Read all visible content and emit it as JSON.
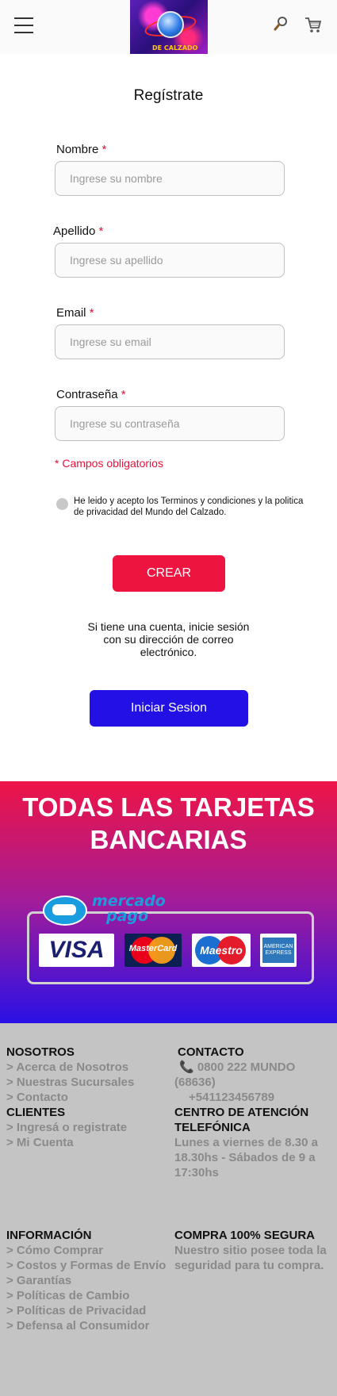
{
  "header": {
    "menu_icon": "hamburger-menu-icon",
    "logo_text": "DE CALZADO",
    "search_icon": "magnifier-icon",
    "cart_icon": "shopping-cart-icon"
  },
  "form": {
    "title": "Regístrate",
    "fields": [
      {
        "label": "Nombre",
        "placeholder": "Ingrese su nombre"
      },
      {
        "label": "Apellido",
        "placeholder": "Ingrese su apellido"
      },
      {
        "label": "Email",
        "placeholder": "Ingrese su email"
      },
      {
        "label": "Contraseña",
        "placeholder": "Ingrese su contraseña"
      }
    ],
    "required_mark": "*",
    "required_note": "* Campos obligatorios",
    "terms_text": "He leido y acepto los Terminos y condiciones  y la politica de privacidad del Mundo del Calzado.",
    "create_label": "CREAR",
    "login_hint": "Si tiene una cuenta, inicie sesión con su dirección de correo electrónico.",
    "login_label": "Iniciar Sesion"
  },
  "banner": {
    "title": "TODAS LAS TARJETAS BANCARIAS",
    "mercadopago_text_1": "mercado",
    "mercadopago_text_2": "pago",
    "cards": [
      "VISA",
      "MasterCard",
      "Maestro",
      "AMERICAN EXPRESS"
    ]
  },
  "footer": {
    "nosotros": {
      "heading": "NOSOTROS",
      "links": [
        "> Acerca de Nosotros",
        "> Nuestras Sucursales",
        "> Contacto"
      ]
    },
    "clientes": {
      "heading": "CLIENTES",
      "links": [
        "> Ingresá o registrate",
        "> Mi Cuenta"
      ]
    },
    "contacto": {
      "heading": "CONTACTO",
      "phone": "0800 222 MUNDO",
      "phone_code": "(68636)",
      "phone_alt": "+541123456789"
    },
    "centro": {
      "heading_1": "CENTRO DE ATENCIÓN",
      "heading_2": "TELEFÓNICA",
      "hours": [
        "Lunes a viernes de 8.30 a",
        "18.30hs - Sábados de 9 a",
        "17:30hs"
      ]
    },
    "informacion": {
      "heading": "INFORMACIÓN",
      "links": [
        "> Cómo Comprar",
        "> Costos y Formas de Envío",
        "> Garantías",
        "> Políticas de Cambio",
        "> Políticas de Privacidad",
        "> Defensa al Consumidor"
      ]
    },
    "compra": {
      "heading": "COMPRA 100% SEGURA",
      "text": [
        "Nuestro sitio posee toda la",
        "seguridad para tu compra."
      ]
    }
  },
  "colors": {
    "accent_red": "#ee1440",
    "accent_blue": "#2210e4",
    "footer_bg": "#c4c4c4"
  }
}
